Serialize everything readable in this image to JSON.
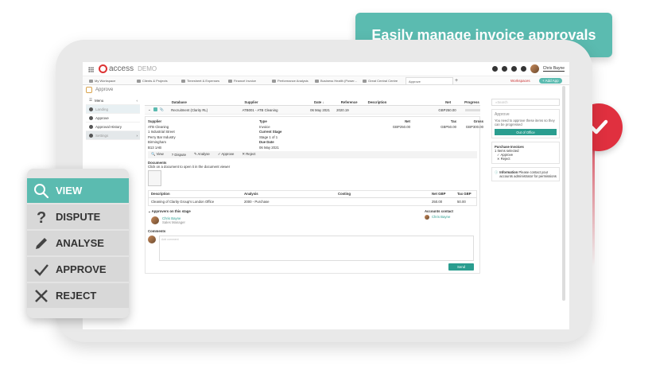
{
  "banner": {
    "text": "Easily manage invoice approvals"
  },
  "app": {
    "logo_text": "access",
    "demo_label": "DEMO",
    "tabs": [
      "My Workspace",
      "Clients & Projects",
      "Timesheet & Expenses",
      "Financé Invoice",
      "Performance Analysis",
      "Business Health (Power...",
      "Great Central Centre",
      "Approve"
    ],
    "user": "Chris Bayne",
    "workspaces": "Workspaces",
    "add_app": "+ Add App",
    "page_title": "Approve"
  },
  "sidebar": {
    "menu": "Menu",
    "items": [
      "Landing",
      "Approve",
      "Approval History",
      "Settings"
    ]
  },
  "table": {
    "headers": [
      "Database",
      "Supplier",
      "Date ↓",
      "Reference",
      "Description",
      "Net",
      "Progress"
    ],
    "row": {
      "database": "Recruitment (Clarity RL)",
      "supplier": "ATB001 - ATB Cleaning",
      "date": "06 May 2021",
      "reference": "2020.19",
      "net": "GBP250.00"
    }
  },
  "details": {
    "supplier_label": "Supplier",
    "supplier_lines": [
      "ATB Cleaning",
      "1 Industrial Street",
      "Perry Bar Industry",
      "Birmingham",
      "B13 1AB"
    ],
    "type_label": "Type",
    "type_value": "Invoice",
    "stage_label": "Current Stage",
    "stage_value": "Stage 1 of 1",
    "due_label": "Due Date",
    "due_value": "06 May 2021",
    "net_label": "Net",
    "net_value": "GBP250.00",
    "tax_label": "Tax",
    "tax_value": "GBP50.00",
    "gross_label": "Gross",
    "gross_value": "GBP300.00"
  },
  "toolbar": [
    "View",
    "Dispute",
    "Analyse",
    "Approve",
    "Reject"
  ],
  "documents": {
    "label": "Documents",
    "hint": "Click on a document to open it in the document viewer"
  },
  "lines": {
    "headers": [
      "Description",
      "Analysis",
      "Costing",
      "Net GBP",
      "Tax GBP"
    ],
    "row": {
      "description": "Cleaning of Clarity Group's London Office",
      "analysis": "2000 - Purchase",
      "costing": "",
      "net": "250.00",
      "tax": "50.00"
    }
  },
  "approvers": {
    "label": "Approvers on this stage",
    "name": "Chris Bayne",
    "role": "Sales Manager",
    "contact_label": "Accounts contact",
    "contact_name": "Chris Bayne"
  },
  "comments": {
    "label": "Comments",
    "placeholder": "Add comment",
    "send": "Send"
  },
  "right_panel": {
    "search_placeholder": "Search",
    "approve_title": "Approve",
    "approve_text": "You need to approve these items so they can be progressed",
    "out_of_office": "Out of Office",
    "purchase_title": "Purchase Invoices",
    "selected": "1 Items selected",
    "actions": [
      "Approve",
      "Reject"
    ],
    "info_title": "Information",
    "info_text": "Please contact your accounts administrator for permissions"
  },
  "menu": {
    "items": [
      "VIEW",
      "DISPUTE",
      "ANALYSE",
      "APPROVE",
      "REJECT"
    ]
  },
  "colors": {
    "teal": "#5bbbb0",
    "red": "#e0303f"
  }
}
